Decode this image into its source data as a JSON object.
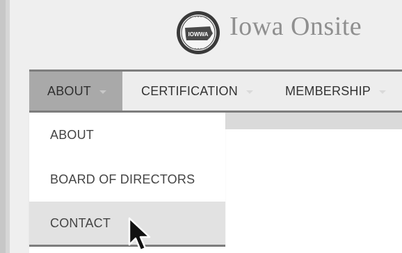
{
  "site": {
    "title": "Iowa Onsite",
    "logo_text": "IOWWA"
  },
  "nav": {
    "items": [
      {
        "label": "ABOUT",
        "active": true,
        "has_caret": true
      },
      {
        "label": "CERTIFICATION",
        "active": false,
        "has_caret": true
      },
      {
        "label": "MEMBERSHIP",
        "active": false,
        "has_caret": true
      }
    ]
  },
  "dropdown": {
    "items": [
      {
        "label": "ABOUT"
      },
      {
        "label": "BOARD OF DIRECTORS"
      },
      {
        "label": "CONTACT",
        "hover": true
      }
    ]
  },
  "colors": {
    "nav_active": "#a9a9a9",
    "nav_border": "#7d7d7d",
    "title": "#8f8f8f",
    "hover_bg": "#e2e2e2"
  },
  "icons": {
    "logo": "iowa-state-seal-icon",
    "cursor": "mouse-pointer-icon",
    "caret": "caret-down-icon"
  }
}
